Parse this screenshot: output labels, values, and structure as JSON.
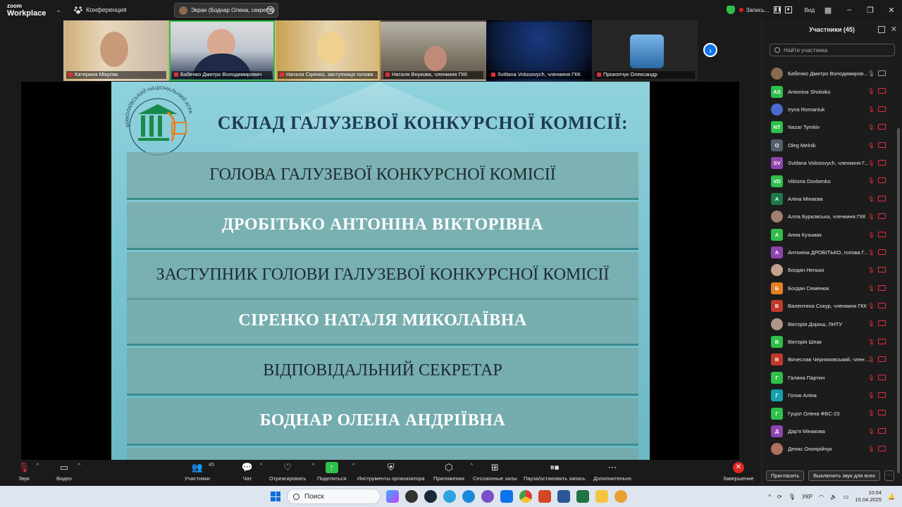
{
  "titlebar": {
    "brand_top": "zoom",
    "brand_bottom": "Workplace",
    "meeting_label": "Конференция",
    "screen_share_label": "Экран (Боднар Олена, секретар",
    "recording_label": "Запись...",
    "view_label": "Вид"
  },
  "gallery": [
    {
      "name": "Катерина Мікуляк"
    },
    {
      "name": "Бабенко Дмитро Володимирович"
    },
    {
      "name": "Наталя Сіренко, заступниця голови ..."
    },
    {
      "name": "Наталя Внукова, членкиня ГКК"
    },
    {
      "name": "Svitlana Volosovych, членкиня ГКК"
    },
    {
      "name": "Прокопчук Олександр"
    }
  ],
  "slide": {
    "title": "СКЛАД ГАЛУЗЕВОЇ КОНКУРСНОЇ КОМІСІЇ:",
    "logo_text": "МИКОЛАЇВСЬКИЙ НАЦІОНАЛЬНИЙ АГРАРНИЙ УНІВЕРСИТЕТ",
    "rows": [
      {
        "text": "ГОЛОВА ГАЛУЗЕВОЇ КОНКУРСНОЇ КОМІСІЇ",
        "bold": false
      },
      {
        "text": "ДРОБІТЬКО АНТОНІНА ВІКТОРІВНА",
        "bold": true
      },
      {
        "text": "ЗАСТУПНИК ГОЛОВИ ГАЛУЗЕВОЇ КОНКУРСНОЇ КОМІСІЇ",
        "bold": false
      },
      {
        "text": "СІРЕНКО НАТАЛЯ МИКОЛАЇВНА",
        "bold": true
      },
      {
        "text": "ВІДПОВІДАЛЬНИЙ СЕКРЕТАР",
        "bold": false
      },
      {
        "text": "БОДНАР ОЛЕНА АНДРІЇВНА",
        "bold": true
      }
    ]
  },
  "participants": {
    "title": "Участники (45)",
    "search_placeholder": "Найти участника",
    "items": [
      {
        "initials": "",
        "name": "Бабенко Дмитро Володимиров...",
        "color": "#8a6a50",
        "mic_on": true
      },
      {
        "initials": "AS",
        "name": "Antonina Sholoiko",
        "color": "#2fbf4a",
        "mic_on": false
      },
      {
        "initials": "",
        "name": "Iryna Romaniuk",
        "color": "#4a6ad0",
        "mic_on": false
      },
      {
        "initials": "NT",
        "name": "Nazar Tymkiv",
        "color": "#2fbf4a",
        "mic_on": false
      },
      {
        "initials": "O",
        "name": "Oleg Melnik",
        "color": "#55606e",
        "mic_on": false
      },
      {
        "initials": "SV",
        "name": "Svitlana Volosovych, членкиня Г...",
        "color": "#8e44ad",
        "mic_on": false
      },
      {
        "initials": "VD",
        "name": "Viktoria Dovbenko",
        "color": "#2fbf4a",
        "mic_on": false
      },
      {
        "initials": "А",
        "name": "Аліна Мінаєва",
        "color": "#1f7a4a",
        "mic_on": false
      },
      {
        "initials": "",
        "name": "Алла Бурковська, членкиня ГКК",
        "color": "#a08070",
        "mic_on": false
      },
      {
        "initials": "А",
        "name": "Анна Кузьмак",
        "color": "#2fbf4a",
        "mic_on": false
      },
      {
        "initials": "А",
        "name": "Антоніна ДРОБІТЬКО, голова Г...",
        "color": "#8e44ad",
        "mic_on": false
      },
      {
        "initials": "",
        "name": "Богдан Ненько",
        "color": "#c8a090",
        "mic_on": false
      },
      {
        "initials": "Б",
        "name": "Богдан Семенюк",
        "color": "#e67e22",
        "mic_on": false
      },
      {
        "initials": "В",
        "name": "Валентина Сокур, членкиня ГКК",
        "color": "#c0392b",
        "mic_on": false
      },
      {
        "initials": "",
        "name": "Вікторія Дорош, ЛНТУ",
        "color": "#b09888",
        "mic_on": false
      },
      {
        "initials": "В",
        "name": "Вікторія Шпак",
        "color": "#2fbf4a",
        "mic_on": false
      },
      {
        "initials": "В",
        "name": "Вячеслав Черняховський, член ...",
        "color": "#c0392b",
        "mic_on": false
      },
      {
        "initials": "Г",
        "name": "Галина Партин",
        "color": "#2fbf4a",
        "mic_on": false
      },
      {
        "initials": "Г",
        "name": "Голик Аліна",
        "color": "#16a0b0",
        "mic_on": false
      },
      {
        "initials": "Г",
        "name": "Гуцол Олена ФБС-23",
        "color": "#2fbf4a",
        "mic_on": false
      },
      {
        "initials": "Д",
        "name": "Дар'я Мінакова",
        "color": "#8e44ad",
        "mic_on": false
      },
      {
        "initials": "",
        "name": "Денис Онопрійчук",
        "color": "#b07060",
        "mic_on": false
      }
    ],
    "invite_label": "Пригласить",
    "mute_all_label": "Выключить звук для всех"
  },
  "toolbar": {
    "audio": "Звук",
    "video": "Видео",
    "participants": "Участники",
    "participants_count": "45",
    "chat": "Чат",
    "react": "Отреагировать",
    "share": "Поделиться",
    "host_tools": "Инструменты организатора",
    "apps": "Приложения",
    "breakout": "Сессионные залы",
    "record": "Пауза/остановить запись",
    "more": "Дополнительно",
    "end": "Завершение"
  },
  "taskbar": {
    "search": "Поиск",
    "lang": "УКР",
    "time": "10:04",
    "date": "15.04.2025"
  }
}
